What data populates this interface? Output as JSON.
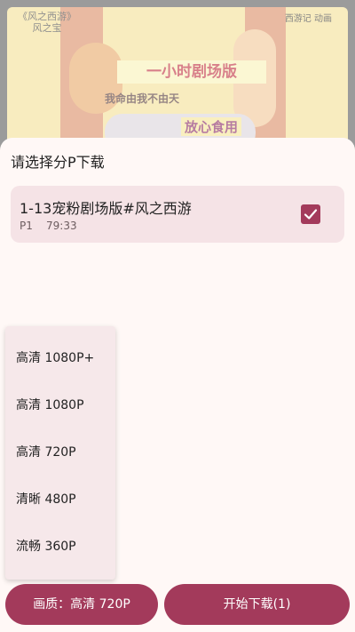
{
  "video": {
    "overlay_top_left": "《风之西游》",
    "overlay_top_left_sub": "风之宝",
    "overlay_top_right": "西游记 动画",
    "banner": "一小时剧场版",
    "subtitle": "我命由我不由天",
    "side_text": "放心食用"
  },
  "sheet": {
    "title": "请选择分P下载",
    "episode": {
      "title": "1-13宠粉剧场版#风之西游",
      "code": "P1",
      "duration": "79:33",
      "selected": true
    },
    "quality_options": [
      {
        "label": "高清 1080P+"
      },
      {
        "label": "高清 1080P"
      },
      {
        "label": "高清 720P"
      },
      {
        "label": "清晰 480P"
      },
      {
        "label": "流畅 360P"
      }
    ],
    "quality_button_label": "画质：高清 720P",
    "download_button_label": "开始下载(1)"
  },
  "colors": {
    "accent": "#a33a5b",
    "card_bg": "#f5e3e6",
    "sheet_bg": "#fff8f6"
  },
  "icons": {
    "checkbox": "check-icon"
  }
}
